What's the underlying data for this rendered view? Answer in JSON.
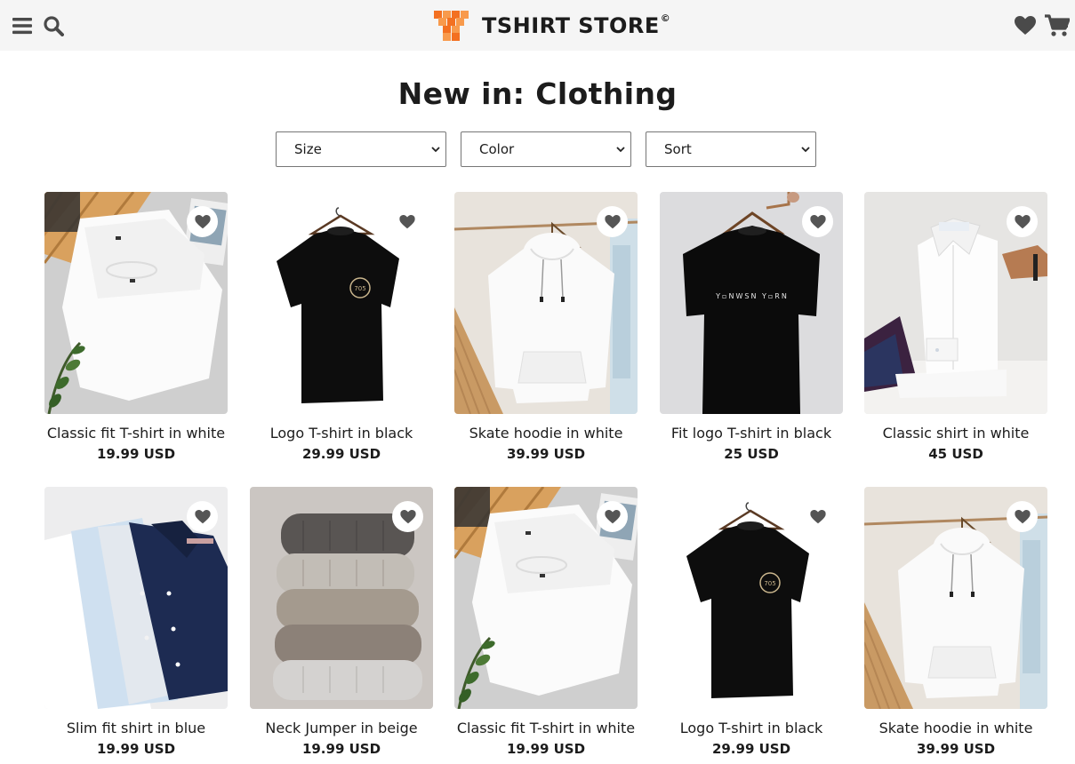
{
  "header": {
    "brand": "TSHIRT STORE",
    "brand_mark": "©",
    "icons": [
      "menu-icon",
      "search-icon",
      "heart-icon",
      "cart-icon"
    ]
  },
  "page": {
    "title": "New in: Clothing"
  },
  "filters": {
    "size": "Size",
    "color": "Color",
    "sort": "Sort"
  },
  "colors": {
    "accent": "#f37021",
    "accent_light": "#f89a4c",
    "text": "#1c1c1c",
    "header_bg": "#f5f5f5",
    "icon": "#4a4a4a"
  },
  "products": [
    {
      "name": "Classic fit T-shirt in white",
      "price": "19.99 USD",
      "image": "white-tshirt-flatlay"
    },
    {
      "name": "Logo T-shirt in black",
      "price": "29.99 USD",
      "image": "black-logo-tshirt-hanger"
    },
    {
      "name": "Skate hoodie in white",
      "price": "39.99 USD",
      "image": "white-hoodie-hanger"
    },
    {
      "name": "Fit logo T-shirt in black",
      "price": "25 USD",
      "image": "black-tshirt-hanger"
    },
    {
      "name": "Classic shirt in white",
      "price": "45 USD",
      "image": "white-dress-shirt"
    },
    {
      "name": "Slim fit shirt in blue",
      "price": "19.99 USD",
      "image": "folded-shirts"
    },
    {
      "name": "Neck Jumper in beige",
      "price": "19.99 USD",
      "image": "folded-jumpers"
    },
    {
      "name": "Classic fit T-shirt in white",
      "price": "19.99 USD",
      "image": "white-tshirt-flatlay"
    },
    {
      "name": "Logo T-shirt in black",
      "price": "29.99 USD",
      "image": "black-logo-tshirt-hanger"
    },
    {
      "name": "Skate hoodie in white",
      "price": "39.99 USD",
      "image": "white-hoodie-hanger"
    }
  ]
}
